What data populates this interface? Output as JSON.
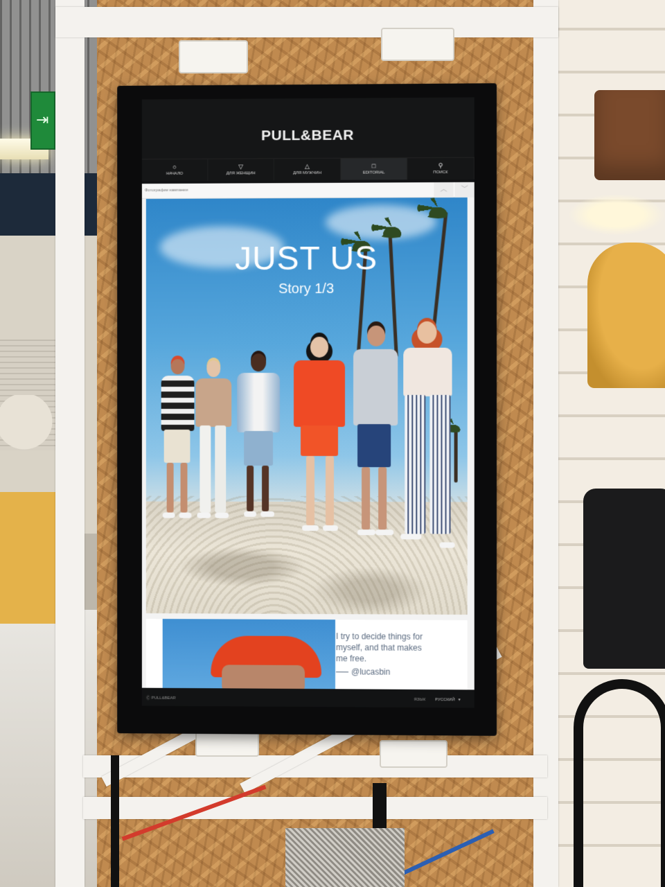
{
  "brand": {
    "logo": "PULL&BEAR"
  },
  "nav": {
    "items": [
      {
        "label": "НАЧАЛО",
        "icon": "circle-icon"
      },
      {
        "label": "ДЛЯ ЖЕНЩИН",
        "icon": "triangle-down-icon"
      },
      {
        "label": "ДЛЯ МУЖЧИН",
        "icon": "triangle-up-icon"
      },
      {
        "label": "EDITORIAL",
        "icon": "square-icon",
        "active": true
      },
      {
        "label": "ПОИСК",
        "icon": "search-icon"
      }
    ]
  },
  "breadcrumb": "Фотографии кампании",
  "hero": {
    "title": "JUST US",
    "subtitle": "Story 1/3"
  },
  "teaser": {
    "quote": "I try to decide things for myself, and that makes me free.",
    "author": "@lucasbin"
  },
  "footer": {
    "copyright": "Ⓒ PULL&BEAR",
    "language_label": "ЯЗЫК",
    "language_value": "РУССКИЙ"
  },
  "colors": {
    "screen_header": "#151617",
    "quote_text": "#5b6b80",
    "hero_sky": "#2f86c9"
  }
}
